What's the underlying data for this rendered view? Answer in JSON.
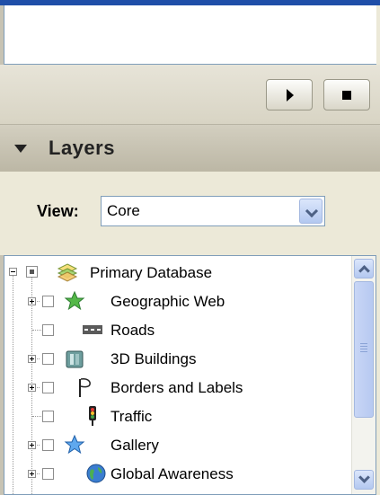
{
  "player": {
    "play_icon": "play-icon",
    "stop_icon": "stop-icon"
  },
  "layers_panel": {
    "title": "Layers",
    "collapse_icon": "collapse-arrow-icon",
    "view_label": "View:",
    "view_value": "Core"
  },
  "tree": {
    "root": {
      "label": "Primary Database",
      "icon": "database-layers-icon"
    },
    "items": [
      {
        "label": "Geographic Web",
        "icon": "green-star-icon"
      },
      {
        "label": "Roads",
        "icon": "road-icon"
      },
      {
        "label": "3D Buildings",
        "icon": "building-icon"
      },
      {
        "label": "Borders and Labels",
        "icon": "flag-icon"
      },
      {
        "label": "Traffic",
        "icon": "traffic-light-icon"
      },
      {
        "label": "Gallery",
        "icon": "blue-star-icon"
      },
      {
        "label": "Global Awareness",
        "icon": "globe-icon"
      }
    ]
  },
  "colors": {
    "titlebar_blue": "#1f4ea8",
    "panel_bg": "#ece9d8",
    "scroll_blue": "#b7c9f1"
  }
}
